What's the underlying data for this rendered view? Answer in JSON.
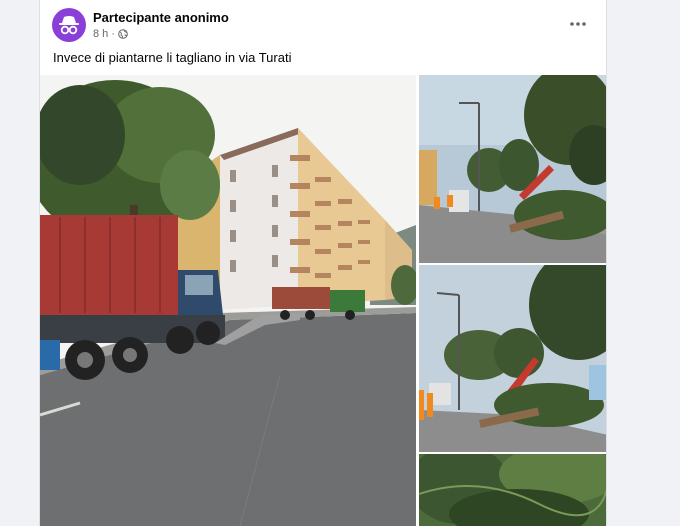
{
  "post": {
    "author": "Partecipante anonimo",
    "time": "8 h",
    "separator": "·",
    "text": "Invece di piantarne li tagliano in via Turati"
  },
  "icons": {
    "avatar": "anonymous-incognito-icon",
    "audience": "globe-icon",
    "more": "more-horizontal-icon"
  },
  "colors": {
    "avatar_bg": "#8b3fd9",
    "page_bg": "#f0f2f5"
  }
}
